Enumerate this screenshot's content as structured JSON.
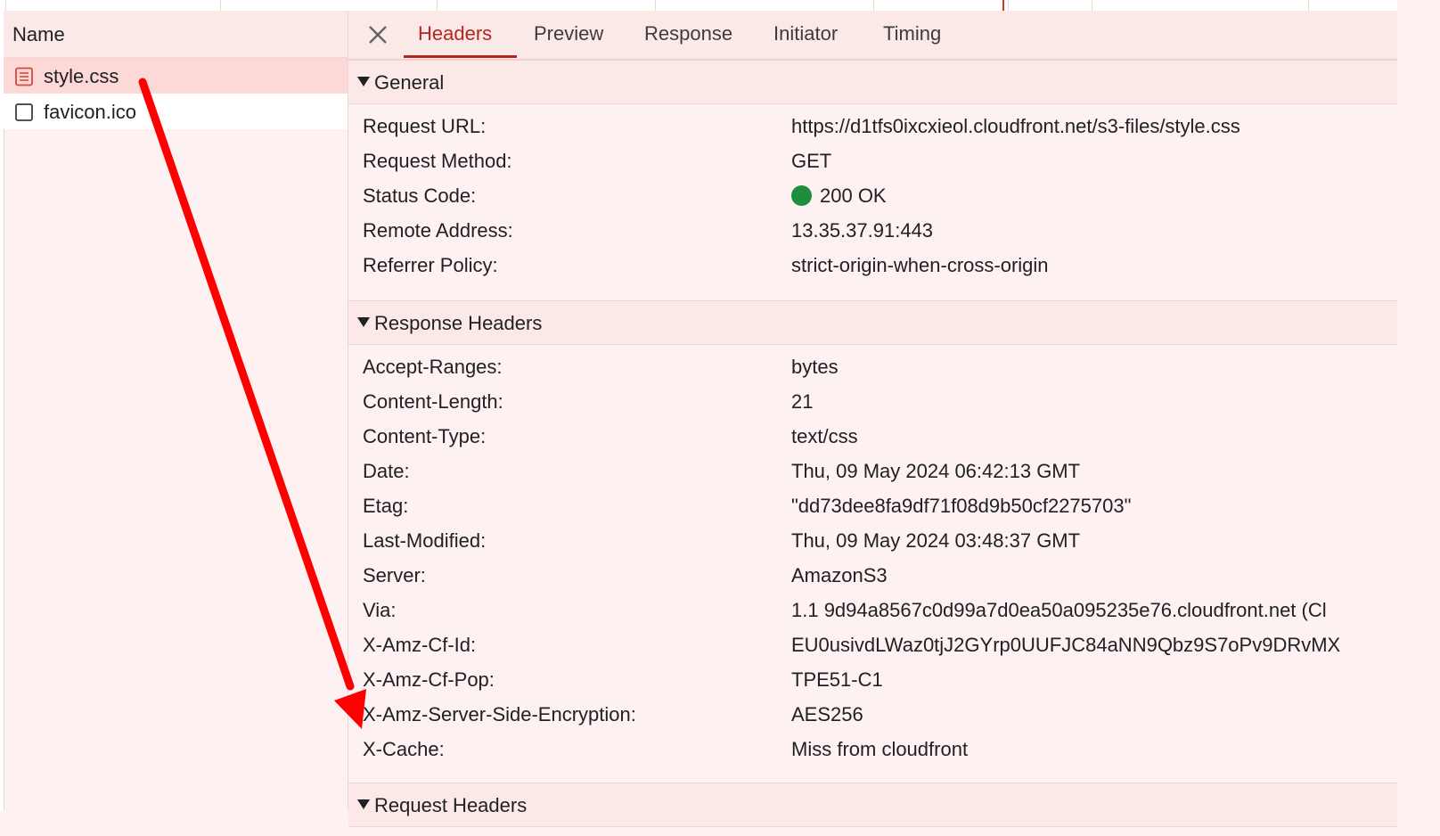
{
  "request_list": {
    "column_header": "Name",
    "items": [
      {
        "label": "style.css",
        "icon": "stylesheet-icon",
        "selected": true
      },
      {
        "label": "favicon.ico",
        "icon": "blank-file-icon",
        "selected": false
      }
    ]
  },
  "tabs": {
    "close_icon": "close-icon",
    "items": [
      "Headers",
      "Preview",
      "Response",
      "Initiator",
      "Timing"
    ],
    "active": "Headers"
  },
  "general": {
    "title": "General",
    "rows": [
      {
        "key": "Request URL:",
        "value": "https://d1tfs0ixcxieol.cloudfront.net/s3-files/style.css"
      },
      {
        "key": "Request Method:",
        "value": "GET"
      },
      {
        "key": "Status Code:",
        "value": "200 OK"
      },
      {
        "key": "Remote Address:",
        "value": "13.35.37.91:443"
      },
      {
        "key": "Referrer Policy:",
        "value": "strict-origin-when-cross-origin"
      }
    ]
  },
  "response_headers": {
    "title": "Response Headers",
    "rows": [
      {
        "key": "Accept-Ranges:",
        "value": "bytes"
      },
      {
        "key": "Content-Length:",
        "value": "21"
      },
      {
        "key": "Content-Type:",
        "value": "text/css"
      },
      {
        "key": "Date:",
        "value": "Thu, 09 May 2024 06:42:13 GMT"
      },
      {
        "key": "Etag:",
        "value": "\"dd73dee8fa9df71f08d9b50cf2275703\""
      },
      {
        "key": "Last-Modified:",
        "value": "Thu, 09 May 2024 03:48:37 GMT"
      },
      {
        "key": "Server:",
        "value": "AmazonS3"
      },
      {
        "key": "Via:",
        "value": "1.1 9d94a8567c0d99a7d0ea50a095235e76.cloudfront.net (Cl"
      },
      {
        "key": "X-Amz-Cf-Id:",
        "value": "EU0usivdLWaz0tjJ2GYrp0UUFJC84aNN9Qbz9S7oPv9DRvMX"
      },
      {
        "key": "X-Amz-Cf-Pop:",
        "value": "TPE51-C1"
      },
      {
        "key": "X-Amz-Server-Side-Encryption:",
        "value": "AES256"
      },
      {
        "key": "X-Cache:",
        "value": "Miss from cloudfront"
      }
    ]
  },
  "request_headers": {
    "title": "Request Headers"
  },
  "colors": {
    "accent": "#b3261e",
    "status_ok": "#1e8e3e",
    "annotation_arrow": "#ff0000",
    "selected_row": "#fcd8d6"
  }
}
